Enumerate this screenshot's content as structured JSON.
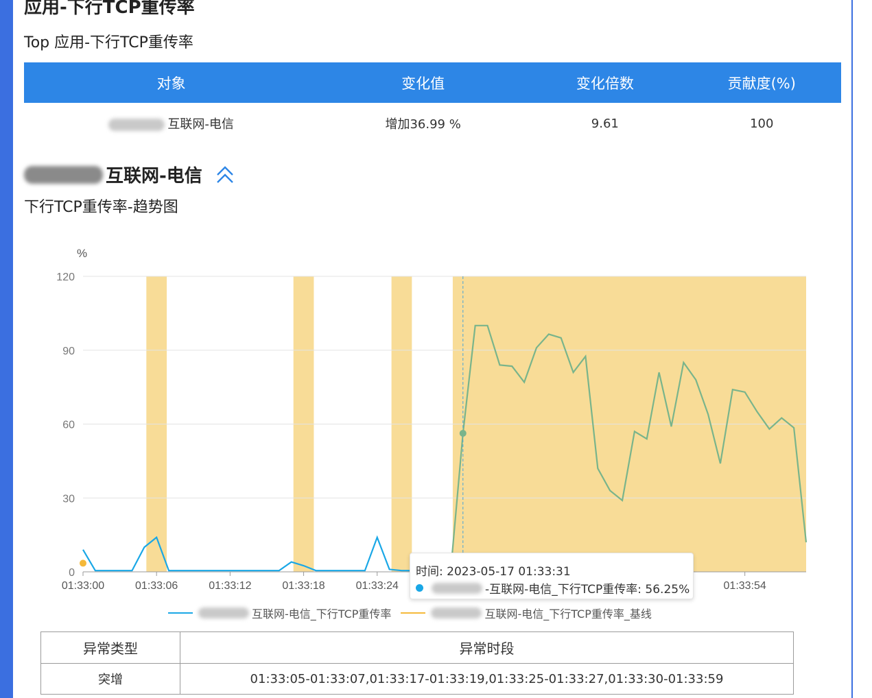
{
  "section": {
    "title": "应用-下行TCP重传率",
    "subtitle": "Top 应用-下行TCP重传率"
  },
  "top_table": {
    "headers": [
      "对象",
      "变化值",
      "变化倍数",
      "贡献度(%)"
    ],
    "row": {
      "object_suffix": "互联网-电信",
      "change_value": "增加36.99 %",
      "multiple": "9.61",
      "contribution": "100"
    }
  },
  "object": {
    "title_suffix": "互联网-电信",
    "collapse_icon": "double-chevron-up-icon"
  },
  "trend": {
    "title": "下行TCP重传率-趋势图"
  },
  "chart_data": {
    "type": "line",
    "ylabel": "%",
    "ylim": [
      0,
      120
    ],
    "yticks": [
      0,
      30,
      60,
      90,
      120
    ],
    "xticks": [
      "01:33:00",
      "01:33:06",
      "01:33:12",
      "01:33:18",
      "01:33:24",
      "01:33:54"
    ],
    "x": [
      "01:33:00",
      "01:33:01",
      "01:33:02",
      "01:33:03",
      "01:33:04",
      "01:33:05",
      "01:33:06",
      "01:33:07",
      "01:33:08",
      "01:33:09",
      "01:33:10",
      "01:33:11",
      "01:33:12",
      "01:33:13",
      "01:33:14",
      "01:33:15",
      "01:33:16",
      "01:33:17",
      "01:33:18",
      "01:33:19",
      "01:33:20",
      "01:33:21",
      "01:33:22",
      "01:33:23",
      "01:33:24",
      "01:33:25",
      "01:33:26",
      "01:33:27",
      "01:33:28",
      "01:33:29",
      "01:33:30",
      "01:33:31",
      "01:33:32",
      "01:33:33",
      "01:33:34",
      "01:33:35",
      "01:33:36",
      "01:33:37",
      "01:33:38",
      "01:33:39",
      "01:33:40",
      "01:33:41",
      "01:33:42",
      "01:33:43",
      "01:33:44",
      "01:33:45",
      "01:33:46",
      "01:33:47",
      "01:33:48",
      "01:33:49",
      "01:33:50",
      "01:33:51",
      "01:33:52",
      "01:33:53",
      "01:33:54",
      "01:33:55",
      "01:33:56",
      "01:33:57",
      "01:33:58",
      "01:33:59"
    ],
    "series": [
      {
        "name": "互联网-电信_下行TCP重传率",
        "color": "#19a7e6",
        "values": [
          9,
          0.5,
          0.5,
          0.5,
          0.5,
          10,
          14,
          0.5,
          0.5,
          0.5,
          0.5,
          0.5,
          0.5,
          0.5,
          0.5,
          0.5,
          0.5,
          4,
          2.5,
          0.5,
          0.5,
          0.5,
          0.5,
          0.5,
          14,
          1,
          0.5,
          0.5,
          0.5,
          0.5,
          0.5,
          56.25,
          100,
          100,
          84,
          83.5,
          77,
          91,
          96.5,
          95,
          81,
          87.5,
          42,
          33,
          29,
          57,
          54,
          81,
          59,
          85,
          78,
          64,
          44,
          74,
          73,
          65,
          58,
          62.5,
          58.5,
          12
        ]
      },
      {
        "name": "互联网-电信_下行TCP重传率_基线",
        "color": "#f5b93a",
        "values": [
          3.5
        ]
      }
    ],
    "anomaly_ranges": [
      [
        "01:33:05",
        "01:33:07"
      ],
      [
        "01:33:17",
        "01:33:19"
      ],
      [
        "01:33:25",
        "01:33:27"
      ],
      [
        "01:33:30",
        "01:33:59"
      ]
    ],
    "anomaly_color": "#f8dc97",
    "anomaly_segment_color": "#79b48b",
    "cursor_x": "01:33:31"
  },
  "tooltip": {
    "time_label": "时间:  2023-05-17 01:33:31",
    "series_suffix": "-互联网-电信_下行TCP重传率:  56.25%"
  },
  "legend": {
    "item1": "互联网-电信_下行TCP重传率",
    "item2": "互联网-电信_下行TCP重传率_基线"
  },
  "anomaly_table": {
    "headers": [
      "异常类型",
      "异常时段"
    ],
    "row": {
      "type": "突增",
      "periods": "01:33:05-01:33:07,01:33:17-01:33:19,01:33:25-01:33:27,01:33:30-01:33:59"
    }
  }
}
